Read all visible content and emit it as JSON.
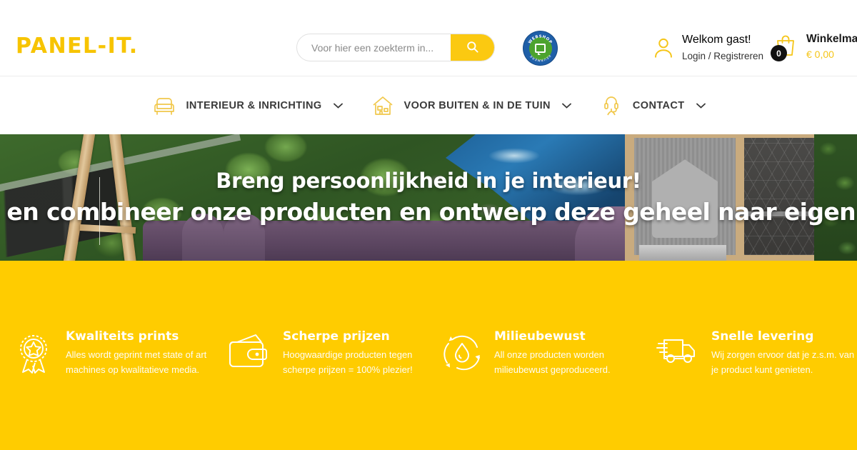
{
  "brand": {
    "logo_text": "PANEL-IT."
  },
  "search": {
    "placeholder": "Voor hier een zoekterm in...",
    "value": "",
    "icon": "search-icon",
    "button_color": "#FBC911"
  },
  "trust_seal": {
    "name": "webshop-keurmerk-seal",
    "top_text": "WEBSHOP",
    "bottom_text": "KEURMERK",
    "ring_color": "#1f5fa8",
    "inner_color": "#4ca32e"
  },
  "account": {
    "icon": "user-icon",
    "welcome": "Welkom gast!",
    "login_link": "Login / Registreren"
  },
  "cart": {
    "icon": "shopping-bag-icon",
    "count": "0",
    "label": "Winkelmand",
    "total": "€ 0,00",
    "total_color": "#F5C518"
  },
  "nav": {
    "items": [
      {
        "label": "INTERIEUR & INRICHTING",
        "icon": "armchair-icon",
        "chevron": "chevron-down-icon"
      },
      {
        "label": "VOOR BUITEN & IN DE TUIN",
        "icon": "house-icon",
        "chevron": "chevron-down-icon"
      },
      {
        "label": "CONTACT",
        "icon": "headset-support-icon",
        "chevron": "chevron-down-icon"
      }
    ]
  },
  "hero": {
    "line1": "Breng persoonlijkheid in je interieur!",
    "line2": "Bestel en combineer onze producten en ontwerp deze geheel naar eigen wens."
  },
  "features": {
    "background_color": "#FFCC00",
    "items": [
      {
        "icon": "award-rosette-icon",
        "title": "Kwaliteits prints",
        "desc": "Alles wordt geprint met state of art machines op kwalitatieve media."
      },
      {
        "icon": "wallet-icon",
        "title": "Scherpe prijzen",
        "desc": "Hoogwaardige producten tegen scherpe prijzen = 100% plezier!"
      },
      {
        "icon": "recycle-droplet-icon",
        "title": "Milieubewust",
        "desc": "All onze producten worden milieubewust geproduceerd."
      },
      {
        "icon": "delivery-truck-icon",
        "title": "Snelle levering",
        "desc": "Wij zorgen ervoor dat je z.s.m. van je product kunt genieten."
      }
    ]
  }
}
